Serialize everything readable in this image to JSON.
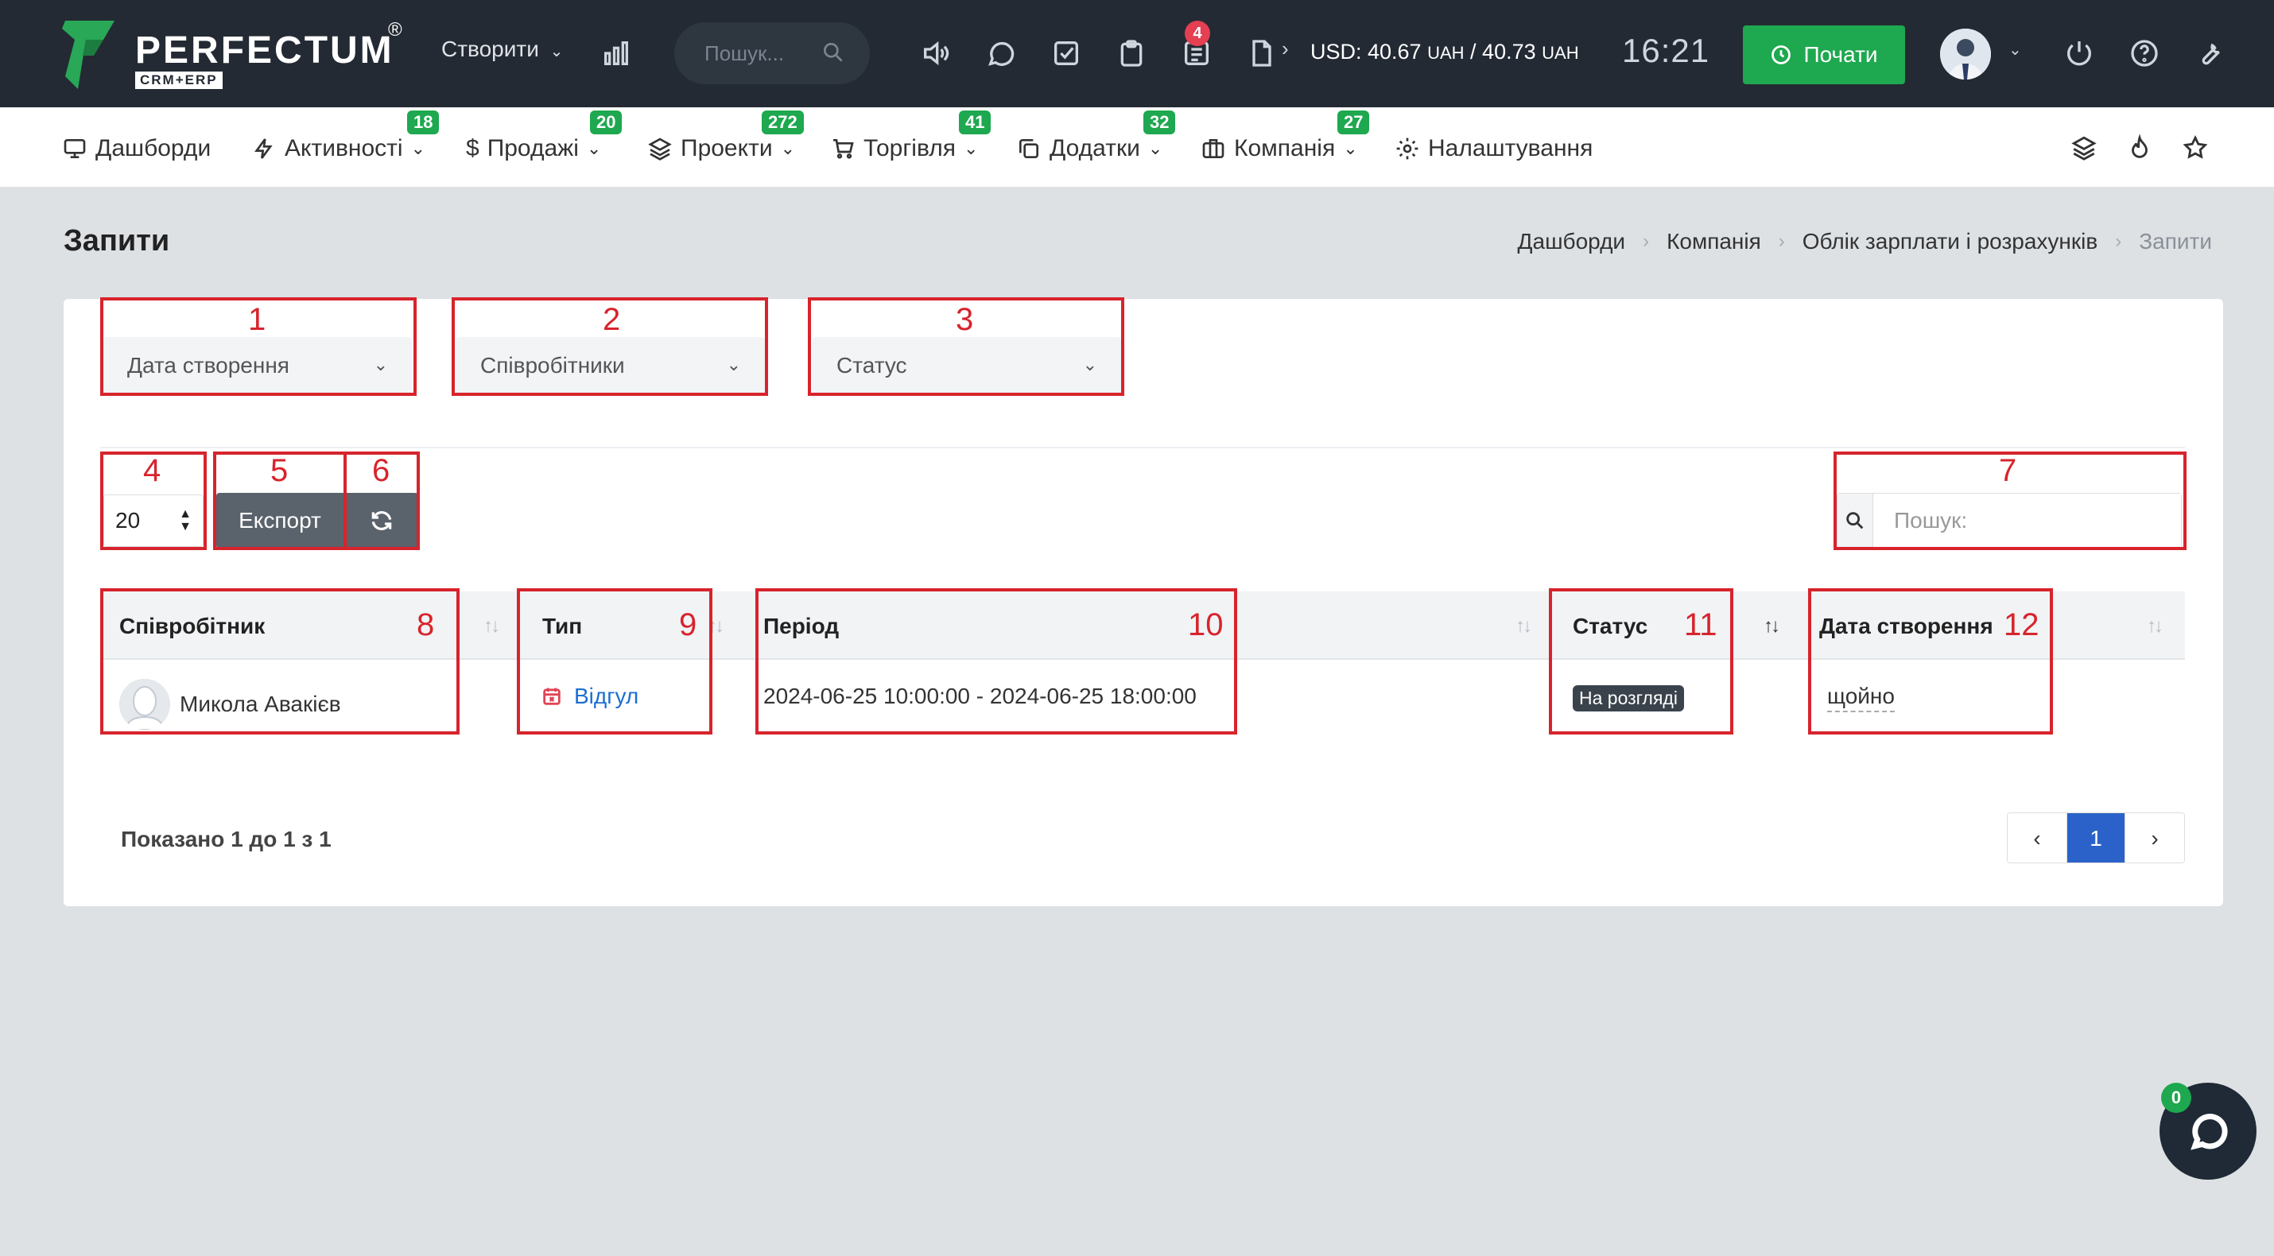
{
  "app": {
    "logo_text": "PERFECTUM",
    "logo_sub": "CRM+ERP",
    "logo_reg": "®"
  },
  "topbar": {
    "create_label": "Створити",
    "search_placeholder": "Пошук...",
    "notifications_count": "4",
    "currency_usd_label": "USD: 40.67",
    "currency_uah1": "UAH",
    "currency_sep": " / 40.73",
    "currency_uah2": "UAH",
    "clock": "16:21",
    "start_label": "Почати"
  },
  "nav": {
    "items": [
      {
        "label": "Дашборди"
      },
      {
        "label": "Активності",
        "badge": "18"
      },
      {
        "label": "Продажі",
        "badge": "20"
      },
      {
        "label": "Проекти",
        "badge": "272"
      },
      {
        "label": "Торгівля",
        "badge": "41"
      },
      {
        "label": "Додатки",
        "badge": "32"
      },
      {
        "label": "Компанія",
        "badge": "27"
      },
      {
        "label": "Налаштування"
      }
    ]
  },
  "page": {
    "title": "Запити",
    "breadcrumb": [
      "Дашборди",
      "Компанія",
      "Облік зарплати і розрахунків",
      "Запити"
    ]
  },
  "filters": {
    "created_date": "Дата створення",
    "employees": "Співробітники",
    "status": "Статус"
  },
  "toolbar": {
    "page_length": "20",
    "export_label": "Експорт",
    "search_placeholder": "Пошук:"
  },
  "table": {
    "columns": [
      "Співробітник",
      "Тип",
      "Період",
      "Статус",
      "Дата створення"
    ],
    "rows": [
      {
        "employee": "Микола Авакієв",
        "type": "Відгул",
        "period": "2024-06-25 10:00:00 - 2024-06-25 18:00:00",
        "status": "На розгляді",
        "created": "щойно"
      }
    ]
  },
  "footer": {
    "shown_text": "Показано 1 до 1 з 1",
    "current_page": "1"
  },
  "chat": {
    "badge": "0"
  },
  "annotations": [
    "1",
    "2",
    "3",
    "4",
    "5",
    "6",
    "7",
    "8",
    "9",
    "10",
    "11",
    "12"
  ],
  "colors": {
    "topbar": "#232a33",
    "accent_green": "#1ea84f",
    "annotation_red": "#d7242c",
    "pager_active": "#2a62c9"
  }
}
